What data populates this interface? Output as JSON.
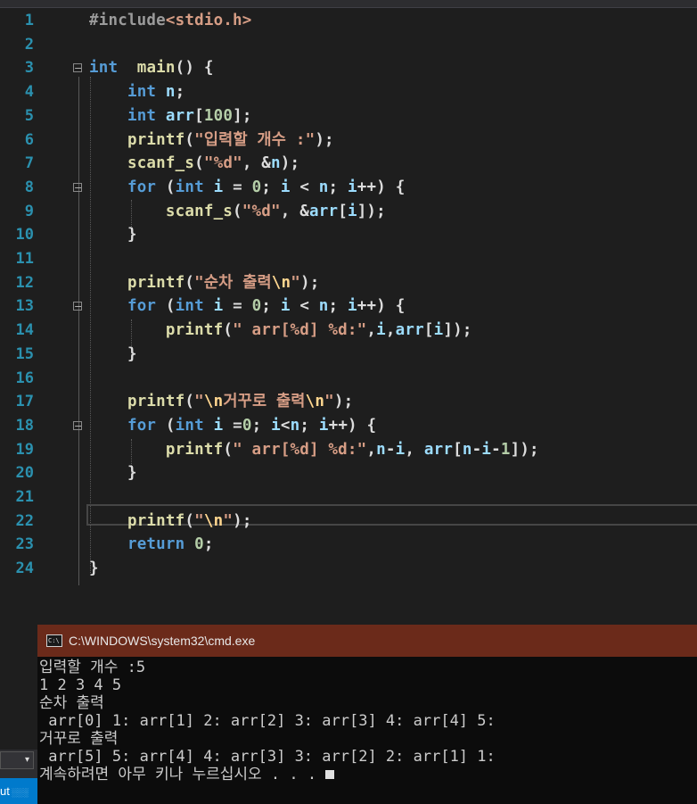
{
  "editor": {
    "lines": [
      {
        "n": "1",
        "parts": [
          [
            "pre",
            "#include"
          ],
          [
            "inc",
            "<stdio.h>"
          ]
        ]
      },
      {
        "n": "2",
        "parts": []
      },
      {
        "n": "3",
        "parts": [
          [
            "kw",
            "int"
          ],
          [
            "",
            "  "
          ],
          [
            "fn",
            "main"
          ],
          [
            "",
            "() {"
          ]
        ]
      },
      {
        "n": "4",
        "parts": [
          [
            "",
            "    "
          ],
          [
            "kw",
            "int"
          ],
          [
            "",
            " "
          ],
          [
            "var",
            "n"
          ],
          [
            "",
            ";"
          ]
        ]
      },
      {
        "n": "5",
        "parts": [
          [
            "",
            "    "
          ],
          [
            "kw",
            "int"
          ],
          [
            "",
            " "
          ],
          [
            "var",
            "arr"
          ],
          [
            "",
            "["
          ],
          [
            "num",
            "100"
          ],
          [
            "",
            "];"
          ]
        ]
      },
      {
        "n": "6",
        "parts": [
          [
            "",
            "    "
          ],
          [
            "fn",
            "printf"
          ],
          [
            "",
            "("
          ],
          [
            "str",
            "\"입력할 개수 :\""
          ],
          [
            "",
            ");"
          ]
        ]
      },
      {
        "n": "7",
        "parts": [
          [
            "",
            "    "
          ],
          [
            "fn",
            "scanf_s"
          ],
          [
            "",
            "("
          ],
          [
            "str",
            "\"%d\""
          ],
          [
            "",
            ", &"
          ],
          [
            "var",
            "n"
          ],
          [
            "",
            ");"
          ]
        ]
      },
      {
        "n": "8",
        "parts": [
          [
            "",
            "    "
          ],
          [
            "kw",
            "for"
          ],
          [
            "",
            " ("
          ],
          [
            "kw",
            "int"
          ],
          [
            "",
            " "
          ],
          [
            "var",
            "i"
          ],
          [
            "",
            " = "
          ],
          [
            "num",
            "0"
          ],
          [
            "",
            "; "
          ],
          [
            "var",
            "i"
          ],
          [
            "",
            " < "
          ],
          [
            "var",
            "n"
          ],
          [
            "",
            "; "
          ],
          [
            "var",
            "i"
          ],
          [
            "",
            "++) {"
          ]
        ]
      },
      {
        "n": "9",
        "parts": [
          [
            "",
            "        "
          ],
          [
            "fn",
            "scanf_s"
          ],
          [
            "",
            "("
          ],
          [
            "str",
            "\"%d\""
          ],
          [
            "",
            ", &"
          ],
          [
            "var",
            "arr"
          ],
          [
            "",
            "["
          ],
          [
            "var",
            "i"
          ],
          [
            "",
            "]);"
          ]
        ]
      },
      {
        "n": "10",
        "parts": [
          [
            "",
            "    }"
          ]
        ]
      },
      {
        "n": "11",
        "parts": []
      },
      {
        "n": "12",
        "parts": [
          [
            "",
            "    "
          ],
          [
            "fn",
            "printf"
          ],
          [
            "",
            "("
          ],
          [
            "str",
            "\"순차 출력"
          ],
          [
            "esc",
            "\\n"
          ],
          [
            "str",
            "\""
          ],
          [
            "",
            ");"
          ]
        ]
      },
      {
        "n": "13",
        "parts": [
          [
            "",
            "    "
          ],
          [
            "kw",
            "for"
          ],
          [
            "",
            " ("
          ],
          [
            "kw",
            "int"
          ],
          [
            "",
            " "
          ],
          [
            "var",
            "i"
          ],
          [
            "",
            " = "
          ],
          [
            "num",
            "0"
          ],
          [
            "",
            "; "
          ],
          [
            "var",
            "i"
          ],
          [
            "",
            " < "
          ],
          [
            "var",
            "n"
          ],
          [
            "",
            "; "
          ],
          [
            "var",
            "i"
          ],
          [
            "",
            "++) {"
          ]
        ]
      },
      {
        "n": "14",
        "parts": [
          [
            "",
            "        "
          ],
          [
            "fn",
            "printf"
          ],
          [
            "",
            "("
          ],
          [
            "str",
            "\" arr[%d] %d:\""
          ],
          [
            "",
            ","
          ],
          [
            "var",
            "i"
          ],
          [
            "",
            ","
          ],
          [
            "var",
            "arr"
          ],
          [
            "",
            "["
          ],
          [
            "var",
            "i"
          ],
          [
            "",
            "]);"
          ]
        ]
      },
      {
        "n": "15",
        "parts": [
          [
            "",
            "    }"
          ]
        ]
      },
      {
        "n": "16",
        "parts": []
      },
      {
        "n": "17",
        "parts": [
          [
            "",
            "    "
          ],
          [
            "fn",
            "printf"
          ],
          [
            "",
            "("
          ],
          [
            "str",
            "\""
          ],
          [
            "esc",
            "\\n"
          ],
          [
            "str",
            "거꾸로 출력"
          ],
          [
            "esc",
            "\\n"
          ],
          [
            "str",
            "\""
          ],
          [
            "",
            ");"
          ]
        ]
      },
      {
        "n": "18",
        "parts": [
          [
            "",
            "    "
          ],
          [
            "kw",
            "for"
          ],
          [
            "",
            " ("
          ],
          [
            "kw",
            "int"
          ],
          [
            "",
            " "
          ],
          [
            "var",
            "i"
          ],
          [
            "",
            " ="
          ],
          [
            "num",
            "0"
          ],
          [
            "",
            "; "
          ],
          [
            "var",
            "i"
          ],
          [
            "",
            "<"
          ],
          [
            "var",
            "n"
          ],
          [
            "",
            "; "
          ],
          [
            "var",
            "i"
          ],
          [
            "",
            "++) {"
          ]
        ]
      },
      {
        "n": "19",
        "parts": [
          [
            "",
            "        "
          ],
          [
            "fn",
            "printf"
          ],
          [
            "",
            "("
          ],
          [
            "str",
            "\" arr[%d] %d:\""
          ],
          [
            "",
            ","
          ],
          [
            "var",
            "n"
          ],
          [
            "",
            "-"
          ],
          [
            "var",
            "i"
          ],
          [
            "",
            ", "
          ],
          [
            "var",
            "arr"
          ],
          [
            "",
            "["
          ],
          [
            "var",
            "n"
          ],
          [
            "",
            "-"
          ],
          [
            "var",
            "i"
          ],
          [
            "",
            "-"
          ],
          [
            "num",
            "1"
          ],
          [
            "",
            "]);"
          ]
        ]
      },
      {
        "n": "20",
        "parts": [
          [
            "",
            "    }"
          ]
        ]
      },
      {
        "n": "21",
        "parts": []
      },
      {
        "n": "22",
        "parts": [
          [
            "",
            "    "
          ],
          [
            "fn",
            "printf"
          ],
          [
            "",
            "("
          ],
          [
            "str",
            "\""
          ],
          [
            "esc",
            "\\n"
          ],
          [
            "str",
            "\""
          ],
          [
            "",
            ");"
          ]
        ]
      },
      {
        "n": "23",
        "parts": [
          [
            "",
            "    "
          ],
          [
            "kw",
            "return"
          ],
          [
            "",
            " "
          ],
          [
            "num",
            "0"
          ],
          [
            "",
            ";"
          ]
        ]
      },
      {
        "n": "24",
        "parts": [
          [
            "",
            "}"
          ]
        ]
      }
    ]
  },
  "console": {
    "title": "C:\\WINDOWS\\system32\\cmd.exe",
    "icon_label": "C:\\",
    "lines": [
      "입력할 개수 :5",
      "1 2 3 4 5",
      "순차 출력",
      " arr[0] 1: arr[1] 2: arr[2] 3: arr[3] 4: arr[4] 5:",
      "거꾸로 출력",
      " arr[5] 5: arr[4] 4: arr[3] 3: arr[2] 2: arr[1] 1:",
      "계속하려면 아무 키나 누르십시오 . . . "
    ]
  },
  "side": {
    "dropdown_glyph": "▾",
    "tab_label": "ut",
    "tab_hatch": "░░░"
  },
  "colors": {
    "keyword": "#569cd6",
    "function": "#dcdcaa",
    "string": "#d69d85",
    "number": "#b5cea8",
    "line_number": "#2b91af",
    "console_title_bg": "#6b2a1a"
  }
}
